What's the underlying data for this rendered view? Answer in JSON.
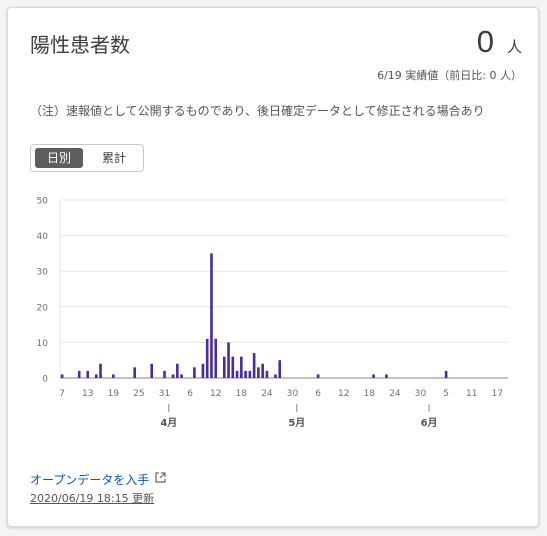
{
  "card": {
    "title": "陽性患者数",
    "value": "0",
    "unit": "人",
    "subtitle": "6/19 実績値（前日比: 0 人）",
    "note": "（注）速報値として公開するものであり、後日確定データとして修正される場合あり",
    "toggle": {
      "daily_label": "日別",
      "cumulative_label": "累計",
      "selected": "日別"
    },
    "open_data_link": "オープンデータを入手",
    "updated": "2020/06/19 18:15 更新"
  },
  "colors": {
    "bar": "#4a2a9c",
    "grid": "#e6e6e6",
    "axis": "#8a8a8a",
    "link": "#0a55c6"
  },
  "chart_data": {
    "type": "bar",
    "title": "",
    "xlabel": "",
    "ylabel": "",
    "ylim": [
      0,
      50
    ],
    "y_ticks": [
      "0",
      "10",
      "20",
      "30",
      "40",
      "50"
    ],
    "grid": true,
    "x_start": "2020-03-07",
    "x_end": "2020-06-19",
    "x_tick_labels": [
      "7",
      "13",
      "19",
      "25",
      "31",
      "6",
      "12",
      "18",
      "24",
      "30",
      "6",
      "12",
      "18",
      "24",
      "30",
      "5",
      "11",
      "17"
    ],
    "month_labels": [
      "4月",
      "5月",
      "6月"
    ],
    "month_dates": [
      "2020-04-01",
      "2020-05-01",
      "2020-06-01"
    ],
    "series": [
      {
        "points": [
          {
            "date": "2020-03-07",
            "value": 1
          },
          {
            "date": "2020-03-11",
            "value": 2
          },
          {
            "date": "2020-03-13",
            "value": 2
          },
          {
            "date": "2020-03-15",
            "value": 1
          },
          {
            "date": "2020-03-16",
            "value": 4
          },
          {
            "date": "2020-03-19",
            "value": 1
          },
          {
            "date": "2020-03-24",
            "value": 3
          },
          {
            "date": "2020-03-28",
            "value": 4
          },
          {
            "date": "2020-03-31",
            "value": 2
          },
          {
            "date": "2020-04-02",
            "value": 1
          },
          {
            "date": "2020-04-03",
            "value": 4
          },
          {
            "date": "2020-04-04",
            "value": 1
          },
          {
            "date": "2020-04-07",
            "value": 3
          },
          {
            "date": "2020-04-09",
            "value": 4
          },
          {
            "date": "2020-04-10",
            "value": 11
          },
          {
            "date": "2020-04-11",
            "value": 35
          },
          {
            "date": "2020-04-12",
            "value": 11
          },
          {
            "date": "2020-04-14",
            "value": 6
          },
          {
            "date": "2020-04-15",
            "value": 10
          },
          {
            "date": "2020-04-16",
            "value": 6
          },
          {
            "date": "2020-04-17",
            "value": 2
          },
          {
            "date": "2020-04-18",
            "value": 6
          },
          {
            "date": "2020-04-19",
            "value": 2
          },
          {
            "date": "2020-04-20",
            "value": 2
          },
          {
            "date": "2020-04-21",
            "value": 7
          },
          {
            "date": "2020-04-22",
            "value": 3
          },
          {
            "date": "2020-04-23",
            "value": 4
          },
          {
            "date": "2020-04-24",
            "value": 2
          },
          {
            "date": "2020-04-26",
            "value": 1
          },
          {
            "date": "2020-04-27",
            "value": 5
          },
          {
            "date": "2020-05-06",
            "value": 1
          },
          {
            "date": "2020-05-19",
            "value": 1
          },
          {
            "date": "2020-05-22",
            "value": 1
          },
          {
            "date": "2020-06-05",
            "value": 2
          }
        ]
      }
    ]
  }
}
